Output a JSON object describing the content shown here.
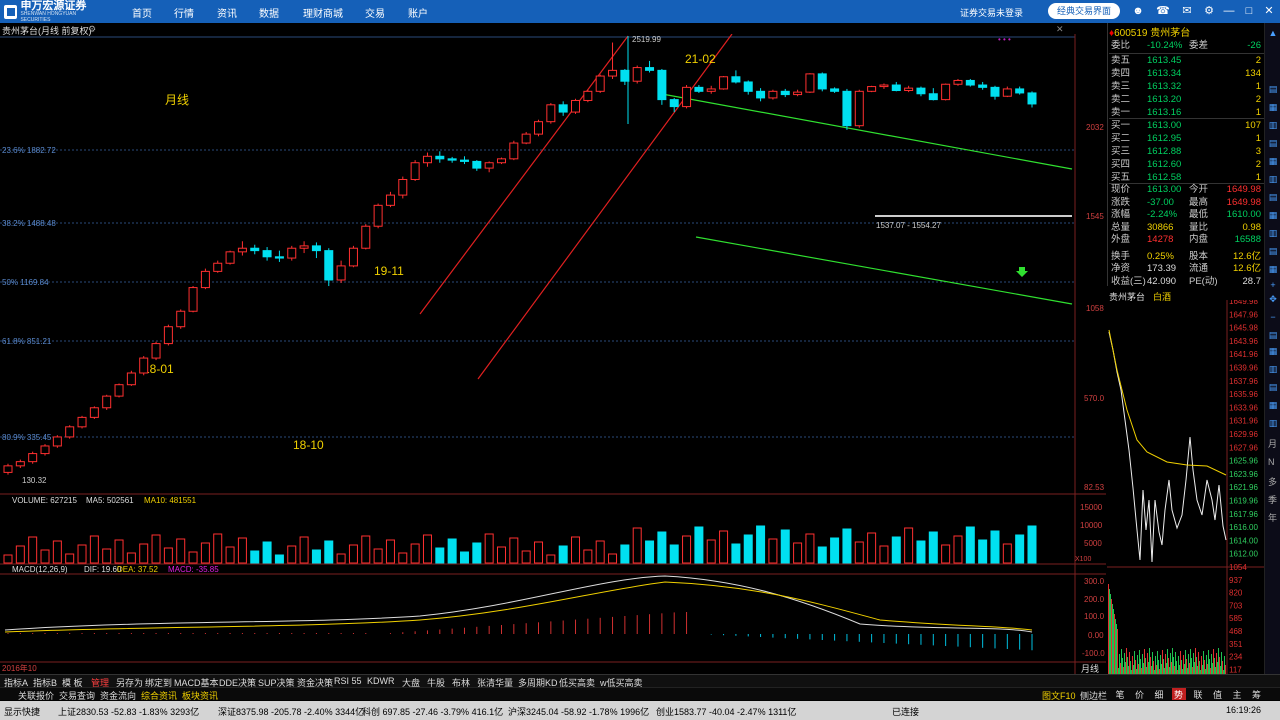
{
  "nav": {
    "logo_text": "申万宏源证券",
    "logo_sub": "SHENWAN HONGYUAN SECURITIES",
    "items": [
      "首页",
      "行情",
      "资讯",
      "数据",
      "理财商城",
      "交易",
      "账户"
    ],
    "login_status": "证券交易未登录",
    "classic_button": "经典交易界面"
  },
  "chart": {
    "title": "贵州茅台(月线 前复权)",
    "period_label": "月线",
    "high_label": "2519.99",
    "low_label": "130.32",
    "range_label": "1537.07 - 1554.27",
    "annotations": [
      "21-02",
      "19-11",
      "18-01",
      "18-10"
    ],
    "fib_levels": [
      "23.6% 1882.72",
      "38.2% 1488.48",
      "50% 1169.84",
      "61.8% 851.21",
      "80.9% 335.45"
    ],
    "yaxis": [
      "2032",
      "1545",
      "1058",
      "570.0",
      "82.53"
    ],
    "volume_header": {
      "title": "VOLUME: 627215",
      "ma5": "MA5: 502561",
      "ma10": "MA10: 481551"
    },
    "volume_axis": [
      "15000",
      "10000",
      "5000",
      "X100"
    ],
    "macd_header": {
      "title": "MACD(12,26,9)",
      "dif": "DIF: 19.60",
      "dea": "DEA: 37.52",
      "macd": "MACD: -35.85"
    },
    "macd_axis": [
      "300.0",
      "200.0",
      "100.0",
      "0.00",
      "-100.0"
    ],
    "xaxis_start": "2016年10",
    "month_line": "月线"
  },
  "quote": {
    "code": "600519",
    "name": "贵州茅台",
    "webi_label": "委比",
    "webi": "-10.24%",
    "weicha_label": "委差",
    "weicha": "-26",
    "asks": [
      {
        "label": "卖五",
        "price": "1613.45",
        "vol": "2"
      },
      {
        "label": "卖四",
        "price": "1613.34",
        "vol": "134"
      },
      {
        "label": "卖三",
        "price": "1613.32",
        "vol": "1"
      },
      {
        "label": "卖二",
        "price": "1613.20",
        "vol": "2"
      },
      {
        "label": "卖一",
        "price": "1613.16",
        "vol": "1"
      }
    ],
    "bids": [
      {
        "label": "买一",
        "price": "1613.00",
        "vol": "107"
      },
      {
        "label": "买二",
        "price": "1612.95",
        "vol": "1"
      },
      {
        "label": "买三",
        "price": "1612.88",
        "vol": "3"
      },
      {
        "label": "买四",
        "price": "1612.60",
        "vol": "2"
      },
      {
        "label": "买五",
        "price": "1612.58",
        "vol": "1"
      }
    ],
    "stats": [
      {
        "l1": "现价",
        "v1": "1613.00",
        "l2": "今开",
        "v2": "1649.98"
      },
      {
        "l1": "涨跌",
        "v1": "-37.00",
        "l2": "最高",
        "v2": "1649.98"
      },
      {
        "l1": "涨幅",
        "v1": "-2.24%",
        "l2": "最低",
        "v2": "1610.00"
      },
      {
        "l1": "总量",
        "v1": "30866",
        "l2": "量比",
        "v2": "0.98"
      },
      {
        "l1": "外盘",
        "v1": "14278",
        "l2": "内盘",
        "v2": "16588"
      },
      {
        "l1": "换手",
        "v1": "0.25%",
        "l2": "股本",
        "v2": "12.6亿"
      },
      {
        "l1": "净资",
        "v1": "173.39",
        "l2": "流通",
        "v2": "12.6亿"
      },
      {
        "l1": "收益(三)",
        "v1": "42.090",
        "l2": "PE(动)",
        "v2": "28.7"
      }
    ]
  },
  "timeline": {
    "title": "贵州茅台",
    "sub": "白酒",
    "axis": [
      "1649.98",
      "1647.96",
      "1645.98",
      "1643.96",
      "1641.96",
      "1639.96",
      "1637.96",
      "1635.96",
      "1633.96",
      "1631.96",
      "1629.96",
      "1627.96",
      "1625.96",
      "1623.96",
      "1621.96",
      "1619.96",
      "1617.96",
      "1616.00",
      "1614.00",
      "1612.00"
    ],
    "vol_axis": [
      "1054",
      "937",
      "820",
      "703",
      "585",
      "468",
      "351",
      "234",
      "117"
    ]
  },
  "tabs": [
    "指标A",
    "指标B",
    "模 板",
    "管理",
    "另存为",
    "绑定到",
    "MACD基本",
    "DDE决策",
    "SUP决策",
    "资金决策",
    "RSI 55",
    "KDWR",
    "大盘",
    "牛股",
    "布林",
    "张清华量",
    "多周期KD",
    "低买高卖",
    "w低买高卖"
  ],
  "tabs2": [
    "关联报价",
    "交易查询",
    "资金流向",
    "综合资讯",
    "板块资讯"
  ],
  "mini_buttons": [
    "笔",
    "价",
    "细",
    "势",
    "联",
    "值",
    "主",
    "筹"
  ],
  "bottom_labels": [
    "图文F10",
    "侧边栏"
  ],
  "sidebar_labels": [
    "月",
    "N",
    "多",
    "季",
    "年"
  ],
  "status": {
    "app": "显示快捷",
    "sh": "上证2830.53  -52.83  -1.83%  3293亿",
    "sz": "深证8375.98  -205.78  -2.40%  3344亿",
    "kc": "科创  697.85  -27.46  -3.79%  416.1亿",
    "hs": "沪深3245.04  -58.92  -1.78%  1996亿",
    "cy": "创业1583.77  -40.04  -2.47%  1311亿",
    "conn": "已连接",
    "time": "16:19:26"
  },
  "colors": {
    "up": "#ff3030",
    "down": "#00e0f0",
    "accent": "#1560b8",
    "channel_up": "#e02020",
    "channel_down": "#30e030"
  }
}
